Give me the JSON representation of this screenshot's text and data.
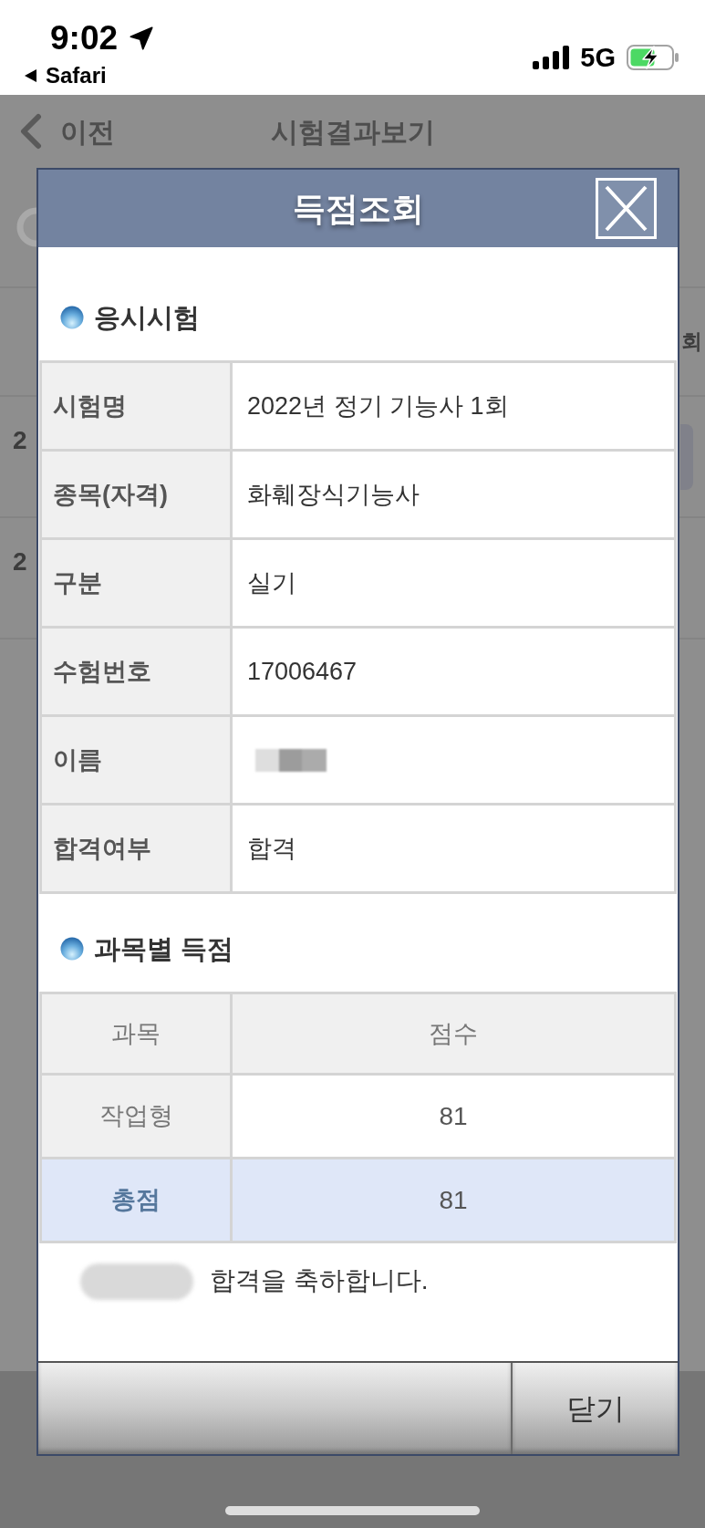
{
  "status_bar": {
    "time": "9:02",
    "back_app": "Safari",
    "network": "5G"
  },
  "background_page": {
    "nav": {
      "back_label": "이전",
      "title": "시험결과보기"
    },
    "header_fragment": "회",
    "rows": [
      {
        "text": "2",
        "has_button": true
      },
      {
        "text": "2",
        "has_button": false
      }
    ]
  },
  "dialog": {
    "title": "득점조회",
    "sections": [
      {
        "kind": "info",
        "title": "응시시험",
        "rows": [
          {
            "label": "시험명",
            "value": "2022년 정기 기능사 1회",
            "redacted": false
          },
          {
            "label": "종목(자격)",
            "value": "화훼장식기능사",
            "redacted": false
          },
          {
            "label": "구분",
            "value": "실기",
            "redacted": false
          },
          {
            "label": "수험번호",
            "value": "17006467",
            "redacted": false
          },
          {
            "label": "이름",
            "redacted": true
          },
          {
            "label": "합격여부",
            "value": "합격",
            "redacted": false
          }
        ]
      },
      {
        "kind": "scores",
        "title": "과목별 득점",
        "columns": [
          "과목",
          "점수"
        ],
        "rows": [
          {
            "subject": "작업형",
            "score": "81",
            "total": false
          },
          {
            "subject": "총점",
            "score": "81",
            "total": true
          }
        ]
      }
    ],
    "message": {
      "name_redacted": true,
      "text": "합격을 축하합니다."
    },
    "buttons": [
      {
        "kind": "blank"
      },
      {
        "kind": "close",
        "label": "닫기"
      }
    ]
  }
}
